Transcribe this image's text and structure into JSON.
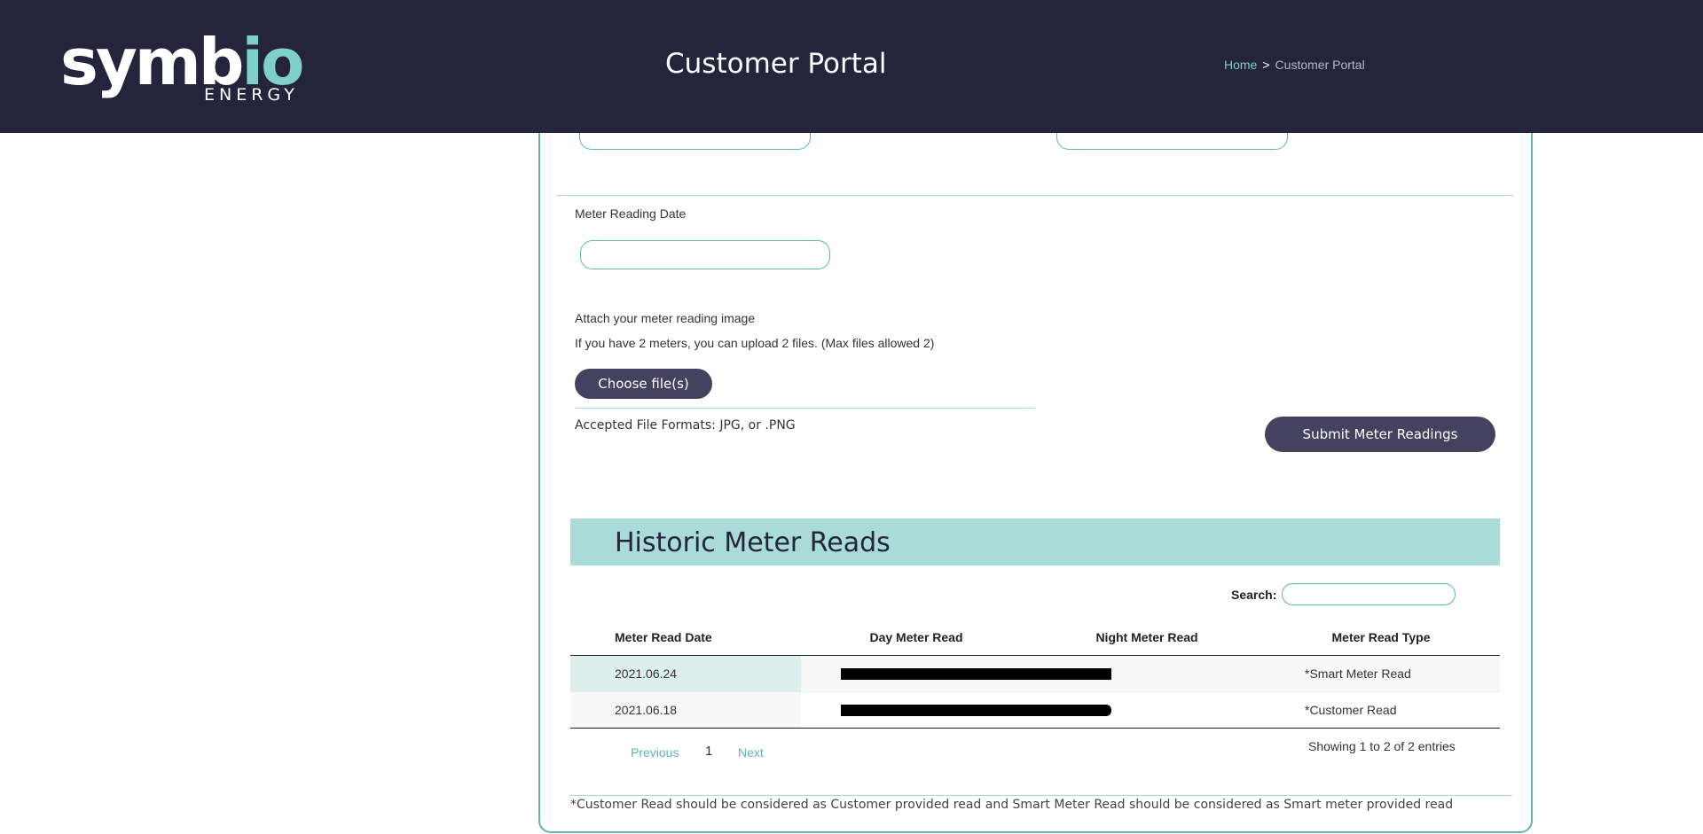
{
  "header": {
    "logo_main": "symb",
    "logo_accent": "io",
    "logo_sub": "ENERGY",
    "title": "Customer Portal",
    "breadcrumb": {
      "home": "Home",
      "separator": ">",
      "current": "Customer Portal"
    }
  },
  "form": {
    "date_label": "Meter Reading Date",
    "date_value": "",
    "attach_label": "Attach your meter reading image",
    "attach_hint": "If you have 2 meters, you can upload 2 files. (Max files allowed 2)",
    "choose_button": "Choose file(s)",
    "accepted_formats": "Accepted File Formats: JPG, or .PNG",
    "submit_button": "Submit Meter Readings"
  },
  "history": {
    "title": "Historic Meter Reads",
    "search_label": "Search:",
    "search_value": "",
    "columns": [
      "Meter Read Date",
      "Day Meter Read",
      "Night Meter Read",
      "Meter Read Type"
    ],
    "rows": [
      {
        "date": "2021.06.24",
        "type": "*Smart Meter Read"
      },
      {
        "date": "2021.06.18",
        "type": "*Customer Read"
      }
    ],
    "pager": {
      "previous": "Previous",
      "current": "1",
      "next": "Next"
    },
    "showing": "Showing 1 to 2 of 2 entries"
  },
  "footnote": "*Customer Read should be considered as Customer provided read and Smart Meter Read should be considered as Smart meter provided read",
  "colors": {
    "header_bg": "#25243d",
    "accent": "#7ed0c8",
    "button": "#44425f",
    "section_bar": "#a9dcd6"
  }
}
